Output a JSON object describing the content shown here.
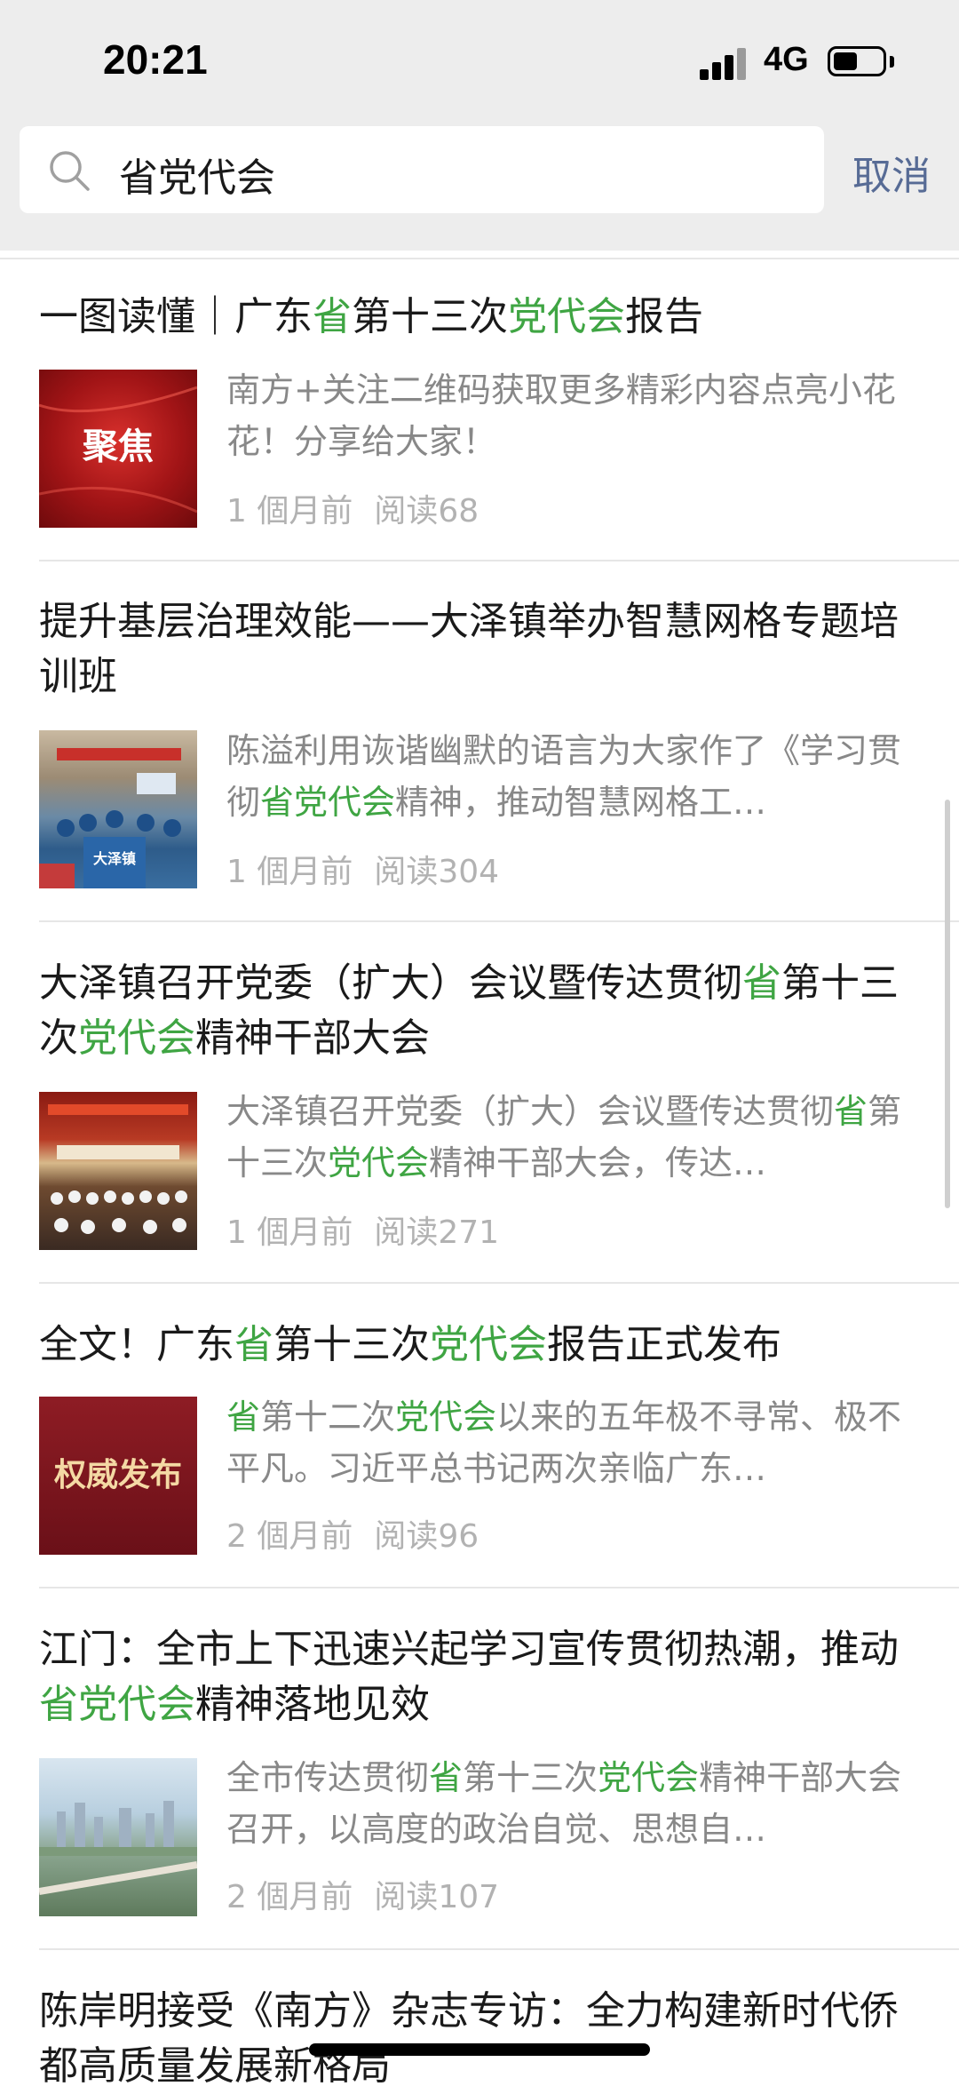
{
  "status": {
    "time": "20:21",
    "network": "4G"
  },
  "search": {
    "query": "省党代会",
    "cancel_label": "取消"
  },
  "colors": {
    "highlight": "#3fa543",
    "link_blue": "#576b95",
    "meta_gray": "#b2b2b2"
  },
  "articles": [
    {
      "title": [
        [
          "一图读懂｜广东",
          0
        ],
        [
          "省",
          1
        ],
        [
          "第十三次",
          0
        ],
        [
          "党代会",
          1
        ],
        [
          "报告",
          0
        ]
      ],
      "thumb_text": "聚焦",
      "desc": [
        [
          "南方+关注二维码获取更多精彩内容点亮小花花！分享给大家！",
          0
        ]
      ],
      "time": "1 個月前",
      "reads": "阅读68"
    },
    {
      "title": [
        [
          "提升基层治理效能——大泽镇举办智慧网格专题培训班",
          0
        ]
      ],
      "thumb_text": "大泽镇",
      "desc": [
        [
          "陈溢利用诙谐幽默的语言为大家作了《学习贯彻",
          0
        ],
        [
          "省党代会",
          1
        ],
        [
          "精神，推动智慧网格工…",
          0
        ]
      ],
      "time": "1 個月前",
      "reads": "阅读304"
    },
    {
      "title": [
        [
          "大泽镇召开党委（扩大）会议暨传达贯彻",
          0
        ],
        [
          "省",
          1
        ],
        [
          "第十三次",
          0
        ],
        [
          "党代会",
          1
        ],
        [
          "精神干部大会",
          0
        ]
      ],
      "thumb_text": "",
      "desc": [
        [
          "大泽镇召开党委（扩大）会议暨传达贯彻",
          0
        ],
        [
          "省",
          1
        ],
        [
          "第十三次",
          0
        ],
        [
          "党代会",
          1
        ],
        [
          "精神干部大会，传达…",
          0
        ]
      ],
      "time": "1 個月前",
      "reads": "阅读271"
    },
    {
      "title": [
        [
          "全文！广东",
          0
        ],
        [
          "省",
          1
        ],
        [
          "第十三次",
          0
        ],
        [
          "党代会",
          1
        ],
        [
          "报告正式发布",
          0
        ]
      ],
      "thumb_text": "权威发布",
      "desc": [
        [
          "省",
          1
        ],
        [
          "第十二次",
          0
        ],
        [
          "党代会",
          1
        ],
        [
          "以来的五年极不寻常、极不平凡。习近平总书记两次亲临广东…",
          0
        ]
      ],
      "time": "2 個月前",
      "reads": "阅读96"
    },
    {
      "title": [
        [
          "江门：全市上下迅速兴起学习宣传贯彻热潮，推动",
          0
        ],
        [
          "省党代会",
          1
        ],
        [
          "精神落地见效",
          0
        ]
      ],
      "thumb_text": "",
      "desc": [
        [
          "全市传达贯彻",
          0
        ],
        [
          "省",
          1
        ],
        [
          "第十三次",
          0
        ],
        [
          "党代会",
          1
        ],
        [
          "精神干部大会召开，以高度的政治自觉、思想自…",
          0
        ]
      ],
      "time": "2 個月前",
      "reads": "阅读107"
    },
    {
      "title": [
        [
          "陈岸明接受《南方》杂志专访：全力构建新时代侨都高质量发展新格局",
          0
        ]
      ]
    }
  ]
}
